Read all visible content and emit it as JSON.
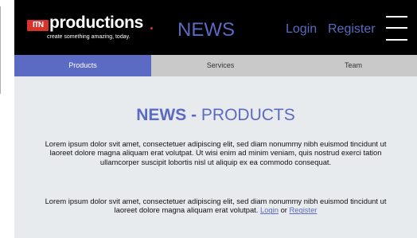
{
  "header": {
    "logo_mark": "ITN",
    "logo_word": "productions",
    "logo_tagline": "create something amazing, today.",
    "title": "NEWS",
    "login_label": "Login",
    "register_label": "Register"
  },
  "tabs": [
    {
      "label": "Products",
      "active": true
    },
    {
      "label": "Services",
      "active": false
    },
    {
      "label": "Team",
      "active": false
    }
  ],
  "content": {
    "heading_strong": "NEWS - ",
    "heading_light": "PRODUCTS",
    "paragraph1": "Lorem ipsum dolor svit amet, consectetuer adipiscing elit, sed diam nonummy nibh euismod tincidunt ut laoreet dolore magna aliquam erat volutpat. Ut wisi enim ad minim veniam, quis nostrud exerci tation ullamcorper suscipit lobortis nisl ut aliquip ex ea commodo consequat.",
    "paragraph2_text": "Lorem ipsum dolor svit amet, consectetuer adipiscing elit, sed diam nonummy nibh euismod tincidunt ut laoreet dolore magna aliquam erat volutpat.",
    "paragraph2_login": "Login",
    "paragraph2_or": "or",
    "paragraph2_register": "Register"
  },
  "colors": {
    "accent": "#5b6ac2",
    "header_bg": "#000000",
    "tab_bg": "#c9c9c9",
    "content_bg": "#e8ebed",
    "logo_red": "#d6332b"
  },
  "icons": {
    "menu": "hamburger-menu-icon"
  }
}
